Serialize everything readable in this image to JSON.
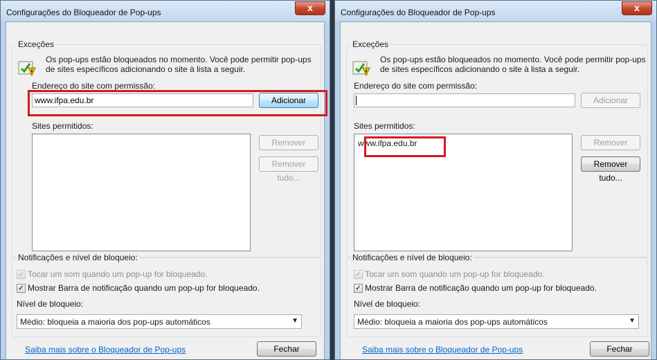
{
  "dialogs": [
    {
      "title": "Configurações do Bloqueador de Pop-ups",
      "close_label": "x",
      "exceptions_label": "Exceções",
      "info_line1": "Os pop-ups estão bloqueados no momento. Você pode permitir pop-ups",
      "info_line2": "de sites específicos adicionando o site à lista a seguir.",
      "address_label": "Endereço do site com permissão:",
      "address_value": "www.ifpa.edu.br",
      "add_button": "Adicionar",
      "allowed_label": "Sites permitidos:",
      "allowed_sites": [],
      "remove_button": "Remover",
      "remove_all_button": "Remover tudo...",
      "notif_label": "Notificações e nível de bloqueio:",
      "sound_label": "Tocar um som quando um pop-up for bloqueado.",
      "bar_label": "Mostrar Barra de notificação quando um pop-up for bloqueado.",
      "level_label": "Nível de bloqueio:",
      "level_value": "Médio: bloqueia a maioria dos pop-ups automáticos",
      "learn_more": "Saiba mais sobre o Bloqueador de Pop-ups",
      "close_button": "Fechar"
    },
    {
      "title": "Configurações do Bloqueador de Pop-ups",
      "close_label": "x",
      "exceptions_label": "Exceções",
      "info_line1": "Os pop-ups estão bloqueados no momento. Você pode permitir pop-ups",
      "info_line2": "de sites específicos adicionando o site à lista a seguir.",
      "address_label": "Endereço do site com permissão:",
      "address_value": "",
      "add_button": "Adicionar",
      "allowed_label": "Sites permitidos:",
      "allowed_sites": [
        "www.ifpa.edu.br"
      ],
      "remove_button": "Remover",
      "remove_all_button": "Remover tudo...",
      "notif_label": "Notificações e nível de bloqueio:",
      "sound_label": "Tocar um som quando um pop-up for bloqueado.",
      "bar_label": "Mostrar Barra de notificação quando um pop-up for bloqueado.",
      "level_label": "Nível de bloqueio:",
      "level_value": "Médio: bloqueia a maioria dos pop-ups automáticos",
      "learn_more": "Saiba mais sobre o Bloqueador de Pop-ups",
      "close_button": "Fechar"
    }
  ],
  "colors": {
    "highlight": "#d6181f",
    "link": "#0066cc",
    "title_bar": "#c2d7ee"
  }
}
